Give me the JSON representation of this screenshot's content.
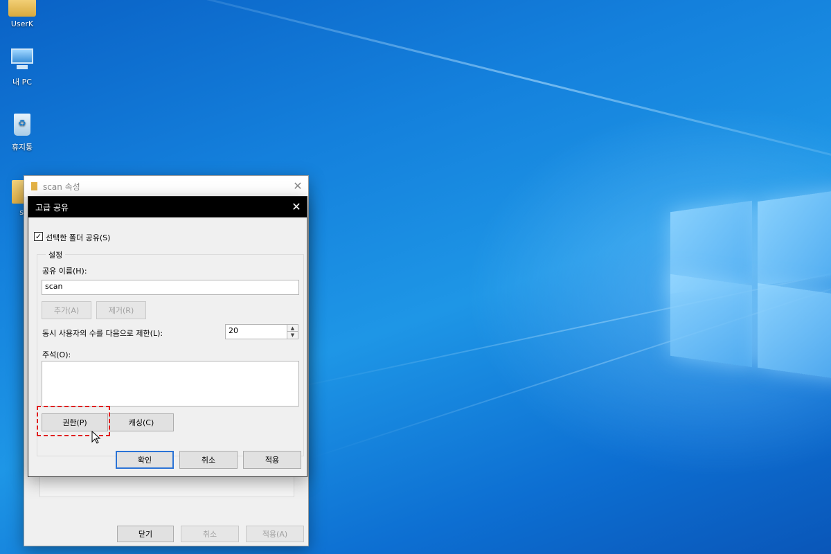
{
  "desktop": {
    "icons": [
      {
        "label": "UserK",
        "icon": "user-folder-icon"
      },
      {
        "label": "내 PC",
        "icon": "computer-icon"
      },
      {
        "label": "휴지통",
        "icon": "recycle-bin-icon"
      },
      {
        "label": "sc",
        "icon": "folder-icon"
      }
    ]
  },
  "props_window": {
    "title": "scan 속성",
    "buttons": {
      "close": "닫기",
      "cancel": "취소",
      "apply": "적용(A)"
    }
  },
  "adv_dialog": {
    "title": "고급 공유",
    "share_checkbox_label": "선택한 폴더 공유(S)",
    "share_checked": true,
    "settings_group": "설정",
    "share_name_label": "공유 이름(H):",
    "share_name_value": "scan",
    "add_button": "추가(A)",
    "remove_button": "제거(R)",
    "limit_label": "동시 사용자의 수를 다음으로 제한(L):",
    "limit_value": "20",
    "comment_label": "주석(O):",
    "comment_value": "",
    "permissions_button": "권한(P)",
    "caching_button": "캐싱(C)",
    "ok_button": "확인",
    "cancel_button": "취소",
    "apply_button": "적용"
  },
  "colors": {
    "highlight": "#e02020",
    "default_button_border": "#2a73d6"
  }
}
